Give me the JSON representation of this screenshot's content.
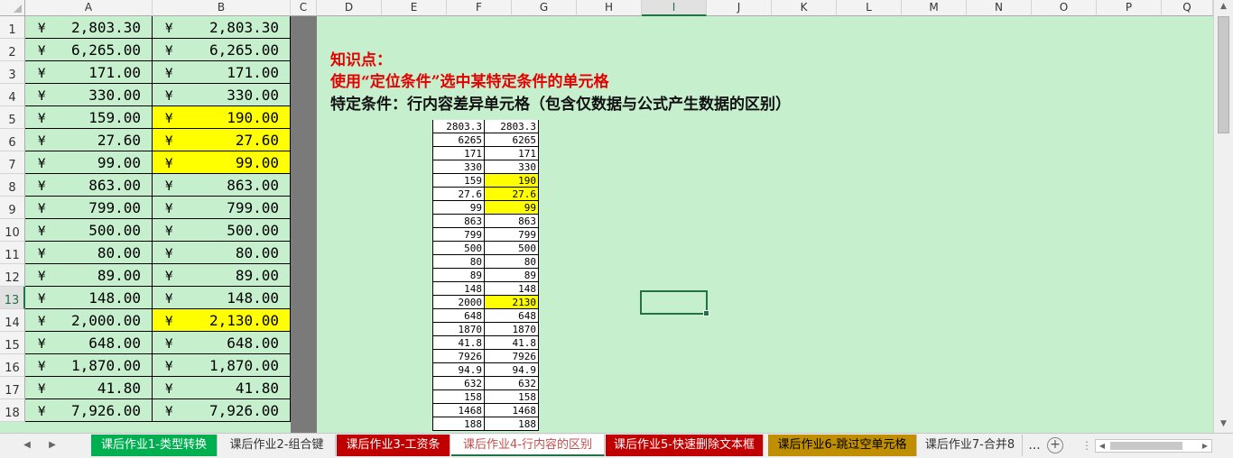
{
  "columns": [
    "A",
    "B",
    "C",
    "D",
    "E",
    "F",
    "G",
    "H",
    "I",
    "J",
    "K",
    "L",
    "M",
    "N",
    "O",
    "P",
    "Q"
  ],
  "selected_column": "I",
  "selected_row": "13",
  "rows": [
    {
      "row": "1",
      "a": "2,803.30",
      "b": "2,803.30",
      "b_hl": false
    },
    {
      "row": "2",
      "a": "6,265.00",
      "b": "6,265.00",
      "b_hl": false
    },
    {
      "row": "3",
      "a": "171.00",
      "b": "171.00",
      "b_hl": false
    },
    {
      "row": "4",
      "a": "330.00",
      "b": "330.00",
      "b_hl": false
    },
    {
      "row": "5",
      "a": "159.00",
      "b": "190.00",
      "b_hl": true
    },
    {
      "row": "6",
      "a": "27.60",
      "b": "27.60",
      "b_hl": true
    },
    {
      "row": "7",
      "a": "99.00",
      "b": "99.00",
      "b_hl": true
    },
    {
      "row": "8",
      "a": "863.00",
      "b": "863.00",
      "b_hl": false
    },
    {
      "row": "9",
      "a": "799.00",
      "b": "799.00",
      "b_hl": false
    },
    {
      "row": "10",
      "a": "500.00",
      "b": "500.00",
      "b_hl": false
    },
    {
      "row": "11",
      "a": "80.00",
      "b": "80.00",
      "b_hl": false
    },
    {
      "row": "12",
      "a": "89.00",
      "b": "89.00",
      "b_hl": false
    },
    {
      "row": "13",
      "a": "148.00",
      "b": "148.00",
      "b_hl": false
    },
    {
      "row": "14",
      "a": "2,000.00",
      "b": "2,130.00",
      "b_hl": true
    },
    {
      "row": "15",
      "a": "648.00",
      "b": "648.00",
      "b_hl": false
    },
    {
      "row": "16",
      "a": "1,870.00",
      "b": "1,870.00",
      "b_hl": false
    },
    {
      "row": "17",
      "a": "41.80",
      "b": "41.80",
      "b_hl": false
    },
    {
      "row": "18",
      "a": "7,926.00",
      "b": "7,926.00",
      "b_hl": false
    }
  ],
  "currency_symbol": "¥",
  "notes": {
    "line1": "知识点：",
    "line2": "使用“定位条件”选中某特定条件的单元格",
    "line3": "特定条件：行内容差异单元格（包含仅数据与公式产生数据的区别）"
  },
  "mini_table": [
    {
      "a": "2803.3",
      "b": "2803.3",
      "hl": false
    },
    {
      "a": "6265",
      "b": "6265",
      "hl": false
    },
    {
      "a": "171",
      "b": "171",
      "hl": false
    },
    {
      "a": "330",
      "b": "330",
      "hl": false
    },
    {
      "a": "159",
      "b": "190",
      "hl": true
    },
    {
      "a": "27.6",
      "b": "27.6",
      "hl": true
    },
    {
      "a": "99",
      "b": "99",
      "hl": true
    },
    {
      "a": "863",
      "b": "863",
      "hl": false
    },
    {
      "a": "799",
      "b": "799",
      "hl": false
    },
    {
      "a": "500",
      "b": "500",
      "hl": false
    },
    {
      "a": "80",
      "b": "80",
      "hl": false
    },
    {
      "a": "89",
      "b": "89",
      "hl": false
    },
    {
      "a": "148",
      "b": "148",
      "hl": false
    },
    {
      "a": "2000",
      "b": "2130",
      "hl": true
    },
    {
      "a": "648",
      "b": "648",
      "hl": false
    },
    {
      "a": "1870",
      "b": "1870",
      "hl": false
    },
    {
      "a": "41.8",
      "b": "41.8",
      "hl": false
    },
    {
      "a": "7926",
      "b": "7926",
      "hl": false
    },
    {
      "a": "94.9",
      "b": "94.9",
      "hl": false
    },
    {
      "a": "632",
      "b": "632",
      "hl": false
    },
    {
      "a": "158",
      "b": "158",
      "hl": false
    },
    {
      "a": "1468",
      "b": "1468",
      "hl": false
    },
    {
      "a": "188",
      "b": "188",
      "hl": false
    }
  ],
  "tabs": [
    {
      "label": "课后作业1-类型转换",
      "bg": "#00b050",
      "color": "#ffffff",
      "active": false
    },
    {
      "label": "课后作业2-组合键",
      "bg": "#f0f0f0",
      "color": "#333333",
      "active": false
    },
    {
      "label": "课后作业3-工资条",
      "bg": "#c00000",
      "color": "#ffffff",
      "active": false
    },
    {
      "label": "课后作业4-行内容的区别",
      "bg": "#ffffff",
      "color": "#c05050",
      "active": true
    },
    {
      "label": "课后作业5-快速删除文本框",
      "bg": "#c00000",
      "color": "#ffffff",
      "active": false
    },
    {
      "label": "课后作业6-跳过空单元格",
      "bg": "#bf8f00",
      "color": "#000000",
      "active": false
    },
    {
      "label": "课后作业7-合并8",
      "bg": "#f0f0f0",
      "color": "#333333",
      "active": false
    }
  ],
  "tab_more_label": "...",
  "colors": {
    "highlight": "#ffff00",
    "sheet_bg": "#c6efce",
    "accent": "#217346",
    "note_red": "#e60000"
  }
}
